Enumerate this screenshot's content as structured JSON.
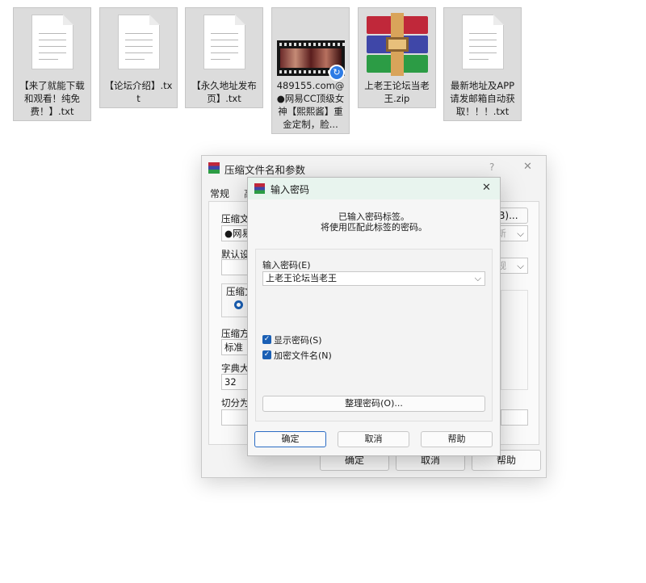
{
  "files": [
    {
      "name": "【来了就能下载和观看！纯免费！】.txt",
      "icon": "text-file-icon"
    },
    {
      "name": "【论坛介绍】.txt",
      "icon": "text-file-icon"
    },
    {
      "name": "【永久地址发布页】.txt",
      "icon": "text-file-icon"
    },
    {
      "name": "489155.com@●网易CC顶级女神【熙熙酱】重金定制，脸...",
      "icon": "video-file-icon"
    },
    {
      "name": "上老王论坛当老王.zip",
      "icon": "winrar-archive-icon"
    },
    {
      "name": "最新地址及APP请发邮箱自动获取！！！.txt",
      "icon": "text-file-icon"
    }
  ],
  "main_dialog": {
    "title": "压缩文件名和参数",
    "help": "?",
    "close": "✕",
    "tab_general": "常规",
    "tab_adv": "高",
    "label_archive_name": "压缩文件",
    "archive_name_value": "●网易",
    "browse_btn": "(B)...",
    "label_default": "默认设置",
    "profile_select": "常规",
    "group_format": "压缩文",
    "format_radio": "R",
    "label_method": "压缩方式",
    "method_value": "标准",
    "label_dict": "字典大小",
    "dict_value": "32",
    "label_split": "切分为分",
    "ok": "确定",
    "cancel": "取消",
    "help_btn": "帮助"
  },
  "password_dialog": {
    "title": "输入密码",
    "close": "✕",
    "info_line1": "已输入密码标签。",
    "info_line2": "将使用匹配此标签的密码。",
    "label_password": "输入密码(E)",
    "password_value": "上老王论坛当老王",
    "show_password": "显示密码(S)",
    "encrypt_names": "加密文件名(N)",
    "manage_btn": "整理密码(O)...",
    "ok": "确定",
    "cancel": "取消",
    "help": "帮助"
  }
}
